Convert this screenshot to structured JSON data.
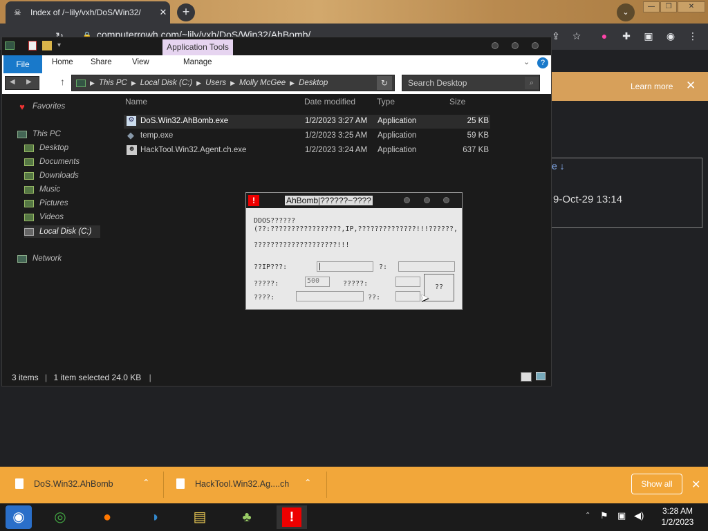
{
  "browser": {
    "tab_title": "Index of /~lily/vxh/DoS/Win32/",
    "tab_close": "✕",
    "new_tab": "+",
    "url": "computerrowh.com/~lily/vxh/DoS/Win32/AhBomb/",
    "window_min": "—",
    "window_max": "❐",
    "window_close": "✕"
  },
  "page": {
    "banner_action": "Learn more",
    "banner_close": "✕",
    "link_fragment": "e ↓",
    "date_fragment": "9-Oct-29 13:14"
  },
  "explorer": {
    "contextual_tab": "Application Tools",
    "ribbon_tabs": [
      "File",
      "Home",
      "Share",
      "View",
      "Manage"
    ],
    "path": [
      "This PC",
      "Local Disk (C:)",
      "Users",
      "Molly McGee",
      "Desktop"
    ],
    "search_placeholder": "Search Desktop",
    "sidebar": {
      "favorites": "Favorites",
      "this_pc": "This PC",
      "items": [
        "Desktop",
        "Documents",
        "Downloads",
        "Music",
        "Pictures",
        "Videos",
        "Local Disk (C:)"
      ],
      "network": "Network"
    },
    "columns": [
      "Name",
      "Date modified",
      "Type",
      "Size"
    ],
    "files": [
      {
        "name": "DoS.Win32.AhBomb.exe",
        "date": "1/2/2023 3:27 AM",
        "type": "Application",
        "size": "25 KB"
      },
      {
        "name": "temp.exe",
        "date": "1/2/2023 3:25 AM",
        "type": "Application",
        "size": "59 KB"
      },
      {
        "name": "HackTool.Win32.Agent.ch.exe",
        "date": "1/2/2023 3:24 AM",
        "type": "Application",
        "size": "637 KB"
      }
    ],
    "status": {
      "items": "3 items",
      "selected": "1 item selected 24.0 KB"
    }
  },
  "dialog": {
    "title": "AhBomb|??????~????",
    "line1": "DDOS??????",
    "line2": "(??:?????????????????,IP,??????????????!!!??????,",
    "line3": "????????????????????!!!",
    "label_ip": "??IP???:",
    "label_q": "?:",
    "label_a": "?????:",
    "value_a": "500",
    "label_b": "?????:",
    "label_c": "????:",
    "label_d": "??:",
    "button": "??"
  },
  "downloads": {
    "items": [
      "DoS.Win32.AhBomb",
      "HackTool.Win32.Ag....ch"
    ],
    "show_all": "Show all",
    "close": "✕"
  },
  "taskbar": {
    "time": "3:28 AM",
    "date": "1/2/2023"
  }
}
